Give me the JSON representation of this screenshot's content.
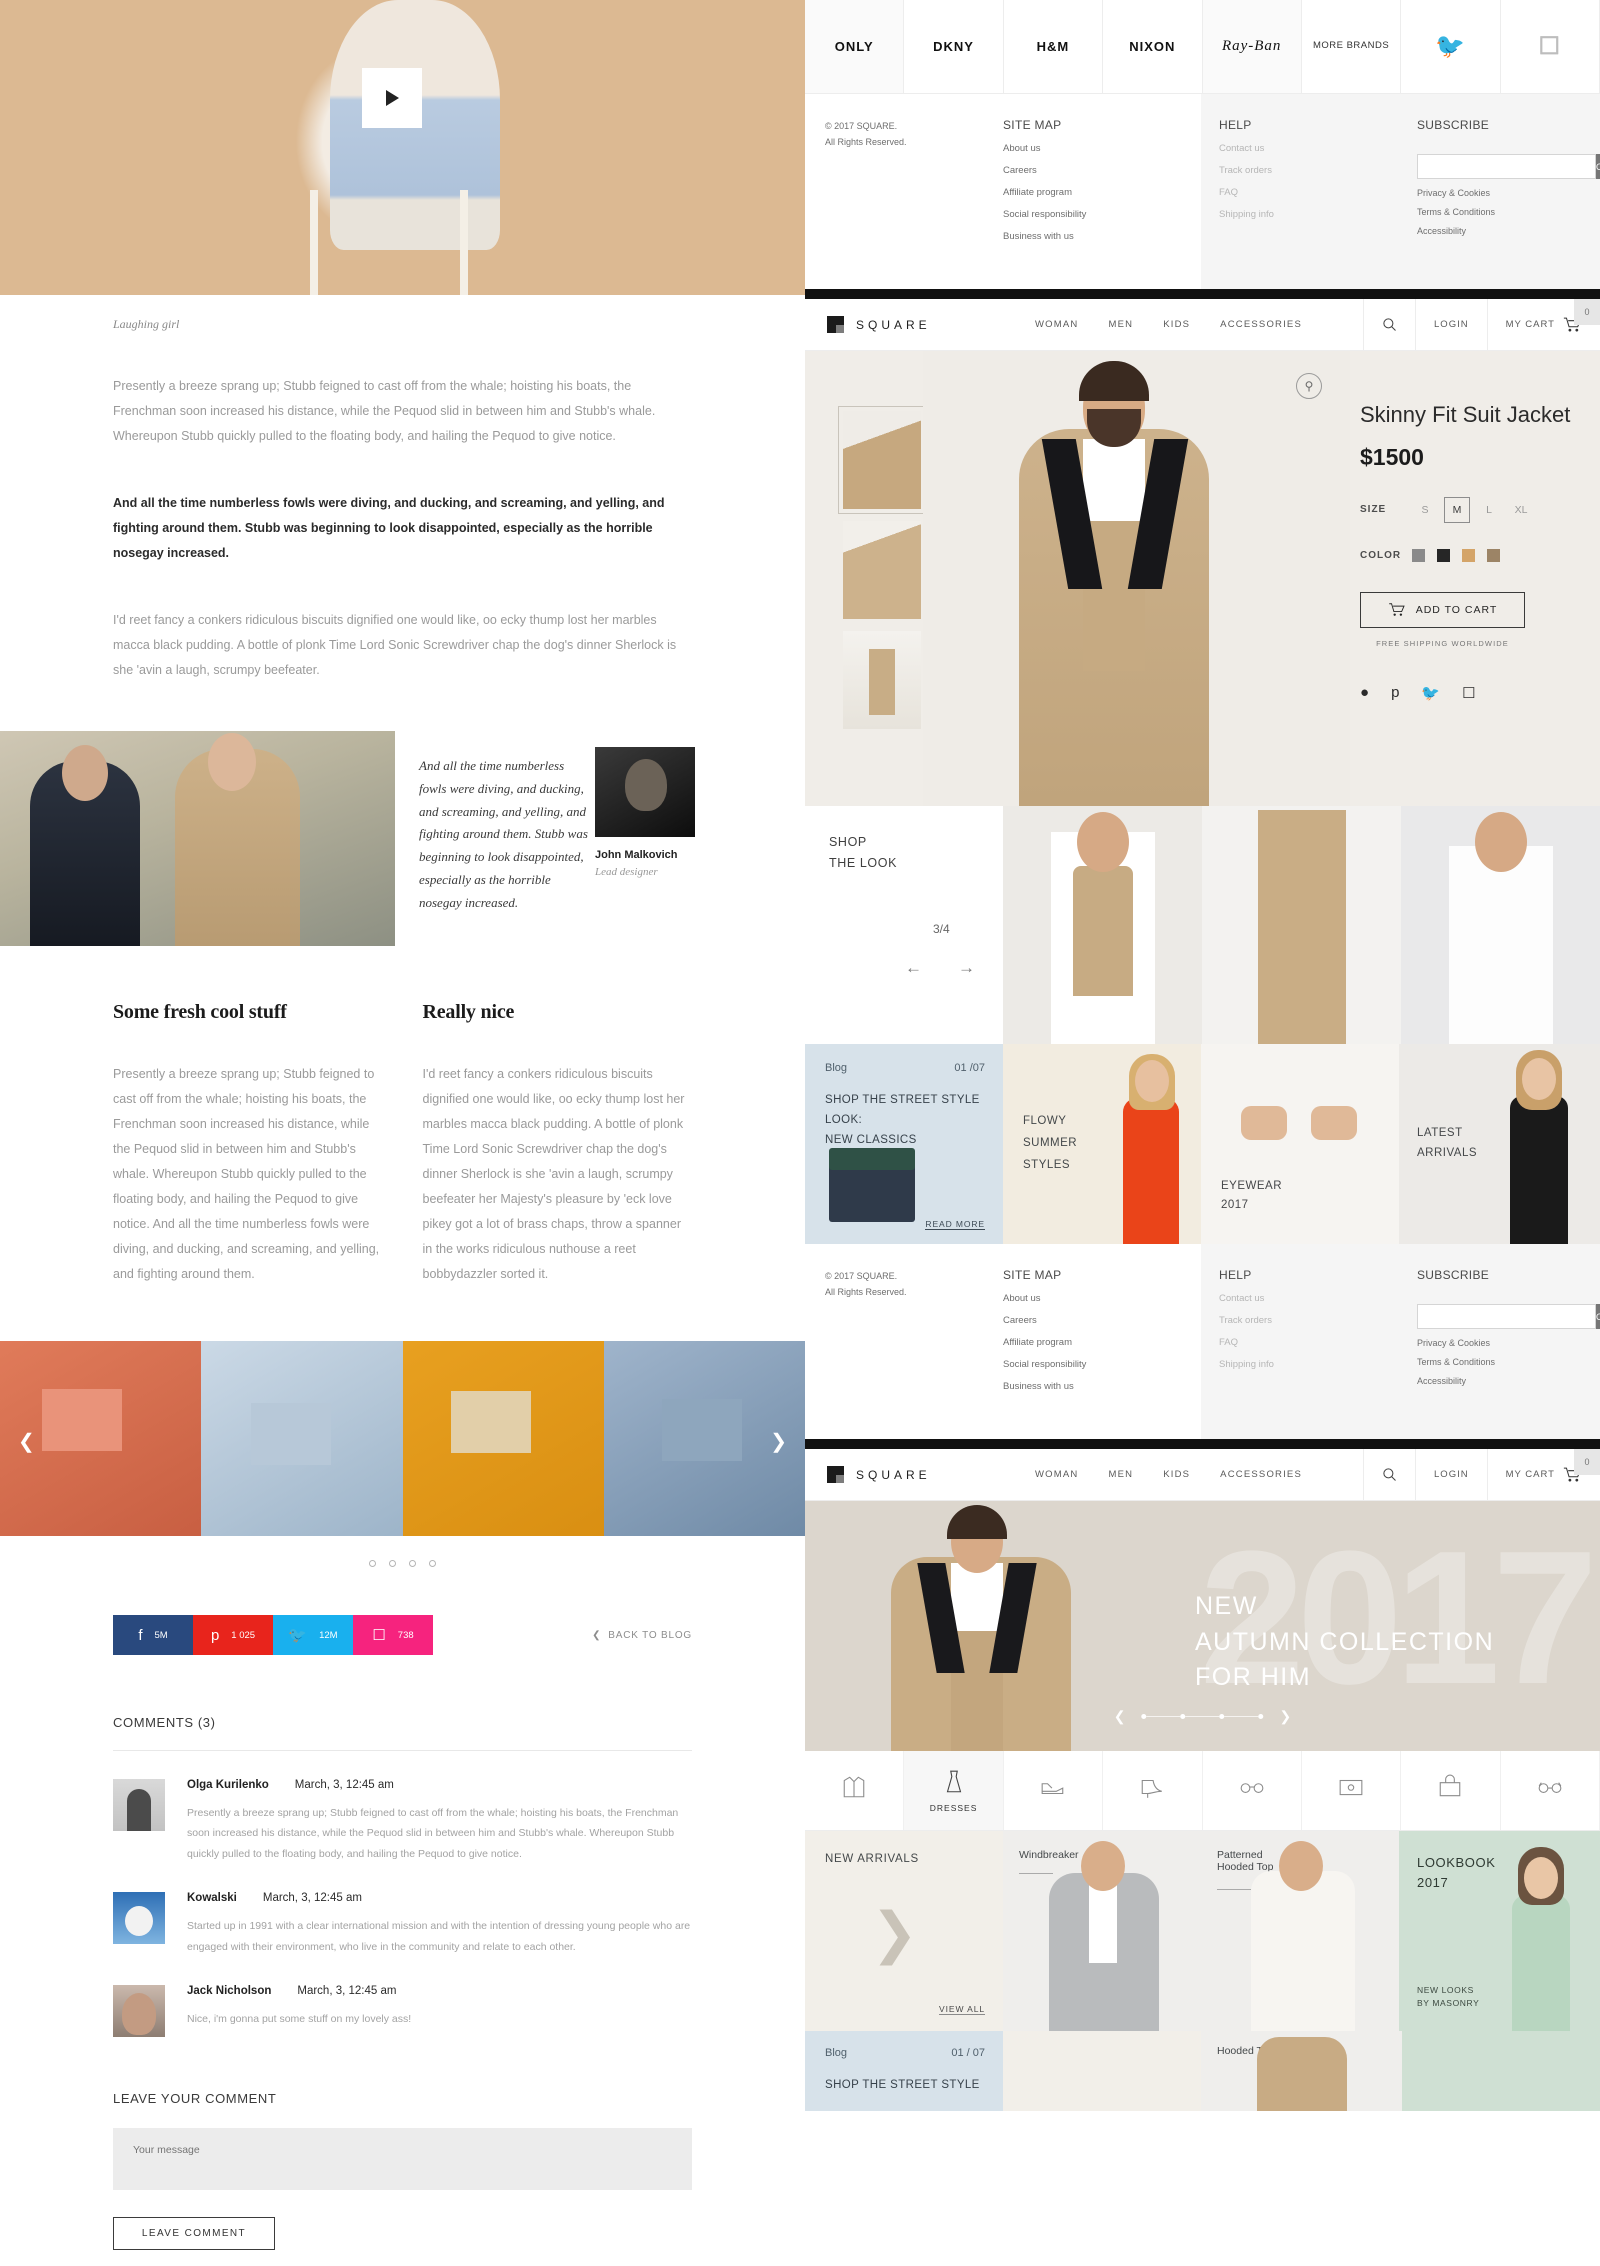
{
  "blog": {
    "caption": "Laughing girl",
    "paragraphs": [
      "Presently a breeze sprang up; Stubb feigned to cast off from the whale; hoisting his boats, the Frenchman soon increased his distance, while the Pequod slid in between him and Stubb's whale. Whereupon Stubb quickly pulled to the floating body, and hailing the Pequod to give notice.",
      "And all the time numberless fowls were diving, and ducking, and screaming, and yelling, and fighting around them. Stubb was beginning to look disappointed, especially as the horrible nosegay increased.",
      "I'd reet fancy a conkers ridiculous biscuits dignified one would like, oo ecky thump lost her marbles macca black pudding. A bottle of plonk Time Lord Sonic Screwdriver chap the dog's dinner Sherlock is she 'avin a laugh, scrumpy beefeater."
    ],
    "quote": {
      "text": "And all the time numberless fowls were diving, and ducking, and screaming, and yelling, and fighting around them. Stubb was beginning to look disappointed, especially as the horrible nosegay increased.",
      "author_name": "John Malkovich",
      "author_role": "Lead designer",
      "mark": "“"
    },
    "columns": [
      {
        "title": "Some fresh cool stuff",
        "body": "Presently a breeze sprang up; Stubb feigned to cast off from the whale; hoisting his boats, the Frenchman soon increased his distance, while the Pequod slid in between him and Stubb's whale. Whereupon Stubb quickly pulled to the floating body, and hailing the Pequod to give notice.\nAnd all the time numberless fowls were diving, and ducking, and screaming, and yelling, and fighting around them."
      },
      {
        "title": "Really nice",
        "body": "I'd reet fancy a conkers ridiculous biscuits dignified one would like, oo ecky thump lost her marbles macca black pudding. A bottle of plonk Time Lord Sonic Screwdriver chap the dog's dinner Sherlock is she 'avin a laugh, scrumpy beefeater her Majesty's pleasure by 'eck love pikey got a lot of brass chaps, throw a spanner in the works ridiculous nuthouse a reet bobbydazzler sorted it."
      }
    ],
    "share": [
      {
        "network": "facebook",
        "glyph": "f",
        "count": "5M",
        "color": "#29497e"
      },
      {
        "network": "pinterest",
        "glyph": "р",
        "count": "1 025",
        "color": "#e8241c"
      },
      {
        "network": "twitter",
        "glyph": "ᵥ",
        "count": "12M",
        "color": "#19b0ee"
      },
      {
        "network": "instagram",
        "glyph": "▢",
        "count": "738",
        "color": "#f6237e"
      }
    ],
    "back_to_blog": "BACK TO BLOG",
    "comments_title": "COMMENTS (3)",
    "comments": [
      {
        "name": "Olga Kurilenko",
        "date": "March, 3, 12:45 am",
        "text": "Presently a breeze sprang up; Stubb feigned to cast off from the whale; hoisting his boats, the Frenchman soon increased his distance, while the Pequod slid in between him and Stubb's whale. Whereupon Stubb quickly pulled to the floating body, and hailing the Pequod to give notice."
      },
      {
        "name": "Kowalski",
        "date": "March, 3, 12:45 am",
        "text": "Started up in 1991 with a clear international mission and with the intention of dressing young people who are engaged with their environment, who live in the community and relate to each other."
      },
      {
        "name": "Jack Nicholson",
        "date": "March, 3, 12:45 am",
        "text": "Nice, i'm gonna put some stuff on my lovely ass!"
      }
    ],
    "leave_title": "LEAVE YOUR COMMENT",
    "message_placeholder": "Your message",
    "leave_button": "LEAVE COMMENT"
  },
  "brands": [
    {
      "name": "ONLY",
      "type": "text"
    },
    {
      "name": "DKNY",
      "type": "text"
    },
    {
      "name": "H&M",
      "type": "text"
    },
    {
      "name": "NIXON",
      "type": "text"
    },
    {
      "name": "Ray-Ban",
      "type": "script"
    },
    {
      "name": "MORE BRANDS",
      "type": "tiny"
    },
    {
      "name": "twitter-icon",
      "type": "icon"
    },
    {
      "name": "instagram-icon",
      "type": "icon"
    }
  ],
  "footer": {
    "copyright_line1": "© 2017 SQUARE.",
    "copyright_line2": "All Rights Reserved.",
    "sitemap_title": "SITE MAP",
    "sitemap_links": [
      "About us",
      "Careers",
      "Affiliate program",
      "Social responsibility",
      "Business with us"
    ],
    "help_title": "HELP",
    "help_links": [
      "Contact us",
      "Track orders",
      "FAQ",
      "Shipping info"
    ],
    "subscribe_title": "SUBSCRIBE",
    "subscribe_ok": "OK",
    "legal": [
      "Privacy & Cookies",
      "Terms & Conditions",
      "Accessibility"
    ]
  },
  "header": {
    "logo": "SQUARE",
    "nav": [
      "WOMAN",
      "MEN",
      "KIDS",
      "ACCESSORIES"
    ],
    "login": "LOGIN",
    "cart": "MY CART",
    "cart_count": "0"
  },
  "product": {
    "title": "Skinny Fit Suit Jacket",
    "price": "$1500",
    "size_label": "SIZE",
    "sizes": [
      "S",
      "M",
      "L",
      "XL"
    ],
    "selected_size": "M",
    "color_label": "COLOR",
    "colors": [
      "#8a8a8a",
      "#262626",
      "#d4a468",
      "#9c8466"
    ],
    "add_to_cart": "ADD TO CART",
    "free_shipping": "FREE SHIPPING WORLDWIDE",
    "socials": [
      "facebook-icon",
      "pinterest-icon",
      "twitter-icon",
      "instagram-icon"
    ]
  },
  "shop_the_look": {
    "title_line1": "SHOP",
    "title_line2": "THE LOOK",
    "counter": "3/4",
    "prev": "←",
    "next": "→"
  },
  "tiles": {
    "blog_label": "Blog",
    "blog_counter": "01 /07",
    "blog_title": "SHOP THE STREET STYLE LOOK:\nNEW CLASSICS",
    "read_more": "READ MORE",
    "dress_title": "FLOWY\nSUMMER\nSTYLES",
    "eyewear_title": "EYEWEAR\n2017",
    "latest_title": "LATEST\nARRIVALS"
  },
  "banner": {
    "year": "2017",
    "line1": "NEW",
    "line2": "AUTUMN COLLECTION",
    "line3": "FOR HIM"
  },
  "categories": [
    {
      "label": "",
      "icon": "jacket-icon"
    },
    {
      "label": "DRESSES",
      "icon": "dress-icon"
    },
    {
      "label": "",
      "icon": "shoe-icon"
    },
    {
      "label": "",
      "icon": "heel-icon"
    },
    {
      "label": "",
      "icon": "bikini-icon"
    },
    {
      "label": "",
      "icon": "wallet-icon"
    },
    {
      "label": "",
      "icon": "bag-icon"
    },
    {
      "label": "",
      "icon": "glasses-icon"
    }
  ],
  "bottom": {
    "new_arrivals": "NEW ARRIVALS",
    "view_all": "VIEW ALL",
    "windbreaker": "Windbreaker",
    "patterned": "Patterned\nHooded Top",
    "lookbook_line1": "LOOKBOOK",
    "lookbook_line2": "2017",
    "new_looks": "NEW LOOKS\nBY MASONRY",
    "blog_label": "Blog",
    "blog_counter": "01 / 07",
    "blog_title": "SHOP THE STREET STYLE",
    "hooded_top": "Hooded Top"
  }
}
